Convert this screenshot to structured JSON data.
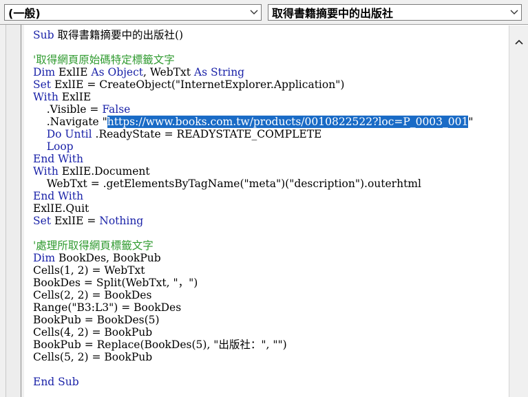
{
  "object_combo": {
    "value": "(一般)",
    "icon": "chevron-down-icon"
  },
  "procedure_combo": {
    "value": "取得書籍摘要中的出版社",
    "icon": "chevron-down-icon"
  },
  "scrollbar": {
    "up_icon": "triangle-up-icon"
  },
  "code_lines": [
    [
      [
        "kw",
        "Sub"
      ],
      [
        "n",
        " 取得書籍摘要中的出版社()"
      ]
    ],
    [
      [
        "n",
        ""
      ]
    ],
    [
      [
        "cm",
        "'取得網頁原始碼特定標籤文字"
      ]
    ],
    [
      [
        "kw",
        "Dim"
      ],
      [
        "n",
        " ExlIE "
      ],
      [
        "kw",
        "As"
      ],
      [
        "n",
        " "
      ],
      [
        "kw",
        "Object"
      ],
      [
        "n",
        ", WebTxt "
      ],
      [
        "kw",
        "As"
      ],
      [
        "n",
        " "
      ],
      [
        "kw",
        "String"
      ]
    ],
    [
      [
        "kw",
        "Set"
      ],
      [
        "n",
        " ExlIE = CreateObject(\"InternetExplorer.Application\")"
      ]
    ],
    [
      [
        "kw",
        "With"
      ],
      [
        "n",
        " ExlIE"
      ]
    ],
    [
      [
        "n",
        "    .Visible = "
      ],
      [
        "kw",
        "False"
      ]
    ],
    [
      [
        "n",
        "    .Navigate \""
      ],
      [
        "sel",
        "https://www.books.com.tw/products/0010822522?loc=P_0003_001"
      ],
      [
        "n",
        "\""
      ]
    ],
    [
      [
        "n",
        "    "
      ],
      [
        "kw",
        "Do Until"
      ],
      [
        "n",
        " .ReadyState = READYSTATE_COMPLETE"
      ]
    ],
    [
      [
        "n",
        "    "
      ],
      [
        "kw",
        "Loop"
      ]
    ],
    [
      [
        "kw",
        "End With"
      ]
    ],
    [
      [
        "kw",
        "With"
      ],
      [
        "n",
        " ExlIE.Document"
      ]
    ],
    [
      [
        "n",
        "    WebTxt = .getElementsByTagName(\"meta\")(\"description\").outerhtml"
      ]
    ],
    [
      [
        "kw",
        "End With"
      ]
    ],
    [
      [
        "n",
        "ExlIE.Quit"
      ]
    ],
    [
      [
        "kw",
        "Set"
      ],
      [
        "n",
        " ExlIE = "
      ],
      [
        "kw",
        "Nothing"
      ]
    ],
    [
      [
        "n",
        ""
      ]
    ],
    [
      [
        "cm",
        "'處理所取得網頁標籤文字"
      ]
    ],
    [
      [
        "kw",
        "Dim"
      ],
      [
        "n",
        " BookDes, BookPub"
      ]
    ],
    [
      [
        "n",
        "Cells(1, 2) = WebTxt"
      ]
    ],
    [
      [
        "n",
        "BookDes = Split(WebTxt, \"，\")"
      ]
    ],
    [
      [
        "n",
        "Cells(2, 2) = BookDes"
      ]
    ],
    [
      [
        "n",
        "Range(\"B3:L3\") = BookDes"
      ]
    ],
    [
      [
        "n",
        "BookPub = BookDes(5)"
      ]
    ],
    [
      [
        "n",
        "Cells(4, 2) = BookPub"
      ]
    ],
    [
      [
        "n",
        "BookPub = Replace(BookDes(5), \"出版社：\", \"\")"
      ]
    ],
    [
      [
        "n",
        "Cells(5, 2) = BookPub"
      ]
    ],
    [
      [
        "n",
        ""
      ]
    ],
    [
      [
        "kw",
        "End Sub"
      ]
    ]
  ]
}
